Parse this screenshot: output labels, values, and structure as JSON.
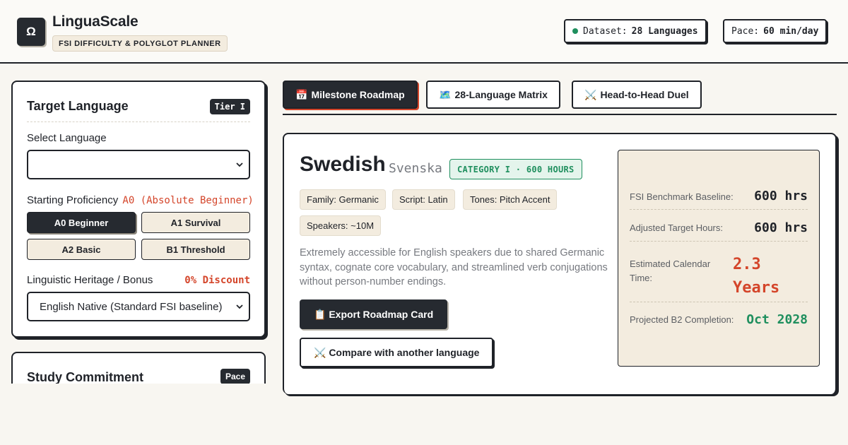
{
  "header": {
    "logo_glyph": "Ω",
    "title": "LinguaScale",
    "subtitle": "FSI DIFFICULTY & POLYGLOT PLANNER",
    "dataset_label": "Dataset:",
    "dataset_value": "28 Languages",
    "pace_label": "Pace:",
    "pace_value": "60 min/day"
  },
  "target_card": {
    "title": "Target Language",
    "tier_badge": "Tier I",
    "select_label": "Select Language",
    "select_value": "",
    "proficiency_label": "Starting Proficiency",
    "proficiency_value": "A0 (Absolute Beginner)",
    "proficiency_options": [
      {
        "label": "A0 Beginner",
        "active": true
      },
      {
        "label": "A1 Survival",
        "active": false
      },
      {
        "label": "A2 Basic",
        "active": false
      },
      {
        "label": "B1 Threshold",
        "active": false
      }
    ],
    "heritage_label": "Linguistic Heritage / Bonus",
    "heritage_discount": "0% Discount",
    "heritage_value": "English Native (Standard FSI baseline)"
  },
  "study_card": {
    "title": "Study Commitment",
    "badge": "Pace"
  },
  "tabs": [
    {
      "icon": "📅",
      "label": "Milestone Roadmap",
      "active": true
    },
    {
      "icon": "🗺️",
      "label": "28-Language Matrix",
      "active": false
    },
    {
      "icon": "⚔️",
      "label": "Head-to-Head Duel",
      "active": false
    }
  ],
  "language": {
    "name": "Swedish",
    "native": "Svenska",
    "category": "CATEGORY I · 600 HOURS",
    "chips": [
      "Family: Germanic",
      "Script: Latin",
      "Tones: Pitch Accent",
      "Speakers: ~10M"
    ],
    "description": "Extremely accessible for English speakers due to shared Germanic syntax, cognate core vocabulary, and streamlined verb conjugations without person-number endings.",
    "export_button": "📋 Export Roadmap Card",
    "compare_button": "⚔️ Compare with another language"
  },
  "stats": [
    {
      "label": "FSI Benchmark Baseline:",
      "value": "600 hrs"
    },
    {
      "label": "Adjusted Target Hours:",
      "value": "600 hrs"
    },
    {
      "label": "Estimated Calendar Time:",
      "value": "2.3 Years"
    },
    {
      "label": "Projected B2 Completion:",
      "value": "Oct 2028"
    }
  ],
  "colors": {
    "accent": "#d4452a",
    "success": "#1f8f5e",
    "ink": "#1f2228",
    "cream": "#f3ecdf"
  }
}
